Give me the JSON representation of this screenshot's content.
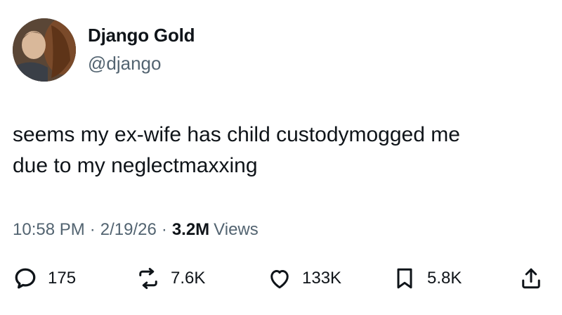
{
  "author": {
    "display_name": "Django Gold",
    "handle": "@django",
    "avatar_icon": "profile-photo-man-with-horse"
  },
  "tweet": {
    "text": "seems my ex-wife has child custodymogged me\ndue to my neglectmaxxing"
  },
  "meta": {
    "time": "10:58 PM",
    "separator": "·",
    "date": "2/19/26",
    "views_count": "3.2M",
    "views_label": "Views"
  },
  "actions": {
    "replies": "175",
    "reposts": "7.6K",
    "likes": "133K",
    "bookmarks": "5.8K"
  },
  "icons": {
    "reply": "reply-icon",
    "repost": "repost-icon",
    "like": "heart-icon",
    "bookmark": "bookmark-icon",
    "share": "share-icon"
  },
  "colors": {
    "text": "#0f1419",
    "secondary": "#536471",
    "background": "#ffffff"
  }
}
